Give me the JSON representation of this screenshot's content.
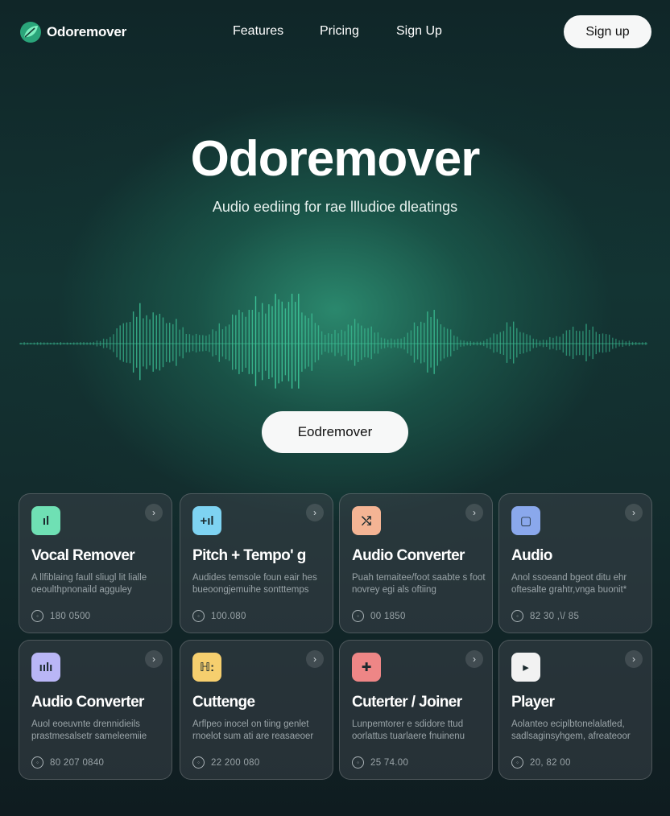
{
  "brand": {
    "name": "Odoremover",
    "accent": "#4fd8a8"
  },
  "nav": {
    "links": [
      "Features",
      "Pricing",
      "Sign Up"
    ],
    "signup_label": "Sign up"
  },
  "hero": {
    "title": "Odoremover",
    "subtitle": "Audio eediing for rae llludioe dleatings",
    "cta_label": "Eodremover"
  },
  "waveform": {
    "color": "#3ec79a",
    "shape": "audio-waveform"
  },
  "cards": [
    {
      "title": "Vocal Remover",
      "desc": "A llfiblaing faull sliugl lit lialle oeoulthpnonaild agguley",
      "meta": "180 0500",
      "icon": "wave-bars-icon",
      "icon_glyph": "ıl",
      "icon_color": "#6fe0b4"
    },
    {
      "title": "Pitch + Tempo' g",
      "desc": "Audides temsole foun eair hes bueoongjemuihe sontttemps",
      "meta": "100.080",
      "icon": "equalizer-icon",
      "icon_glyph": "+ıl",
      "icon_color": "#7ed3f2"
    },
    {
      "title": "Audio Converter",
      "desc": "Puah temaitee/foot saabte s foot novrey egi als oftiing",
      "meta": "00 1850",
      "icon": "convert-icon",
      "icon_glyph": "⤭",
      "icon_color": "#f4b494"
    },
    {
      "title": "Audio",
      "desc": "Anol ssoeand bgeot ditu ehr oftesalte grahtr,vnga buonit*",
      "meta": "82 30 ,\\/ 85",
      "icon": "square-icon",
      "icon_glyph": "▢",
      "icon_color": "#8aa8ec"
    },
    {
      "title": "Audio Converter",
      "desc": "Auol eoeuvnte drennidieils prastmesalsetr sameleemiie",
      "meta": "80 207 0840",
      "icon": "waveform-icon",
      "icon_glyph": "ıılı",
      "icon_color": "#b9b6f6"
    },
    {
      "title": "Cuttenge",
      "desc": "Arflpeo inocel on tiing genlet rnoelot sum ati are reasaeoer",
      "meta": "22 200 080",
      "icon": "cut-icon",
      "icon_glyph": "ℍ:",
      "icon_color": "#f6cf6e"
    },
    {
      "title": "Cuterter / Joiner",
      "desc": "Lunpemtorer e sdidore ttud oorlattus tuarlaere fnuinenu",
      "meta": "25 74.00",
      "icon": "joiner-icon",
      "icon_glyph": "✚",
      "icon_color": "#ee8686"
    },
    {
      "title": "Player",
      "desc": "Aolanteo eciplbtonelalatled, sadlsaginsyhgem, afreateoor",
      "meta": "20, 82 00",
      "icon": "play-icon",
      "icon_glyph": "▸",
      "icon_color": "#f2f2f2"
    }
  ]
}
